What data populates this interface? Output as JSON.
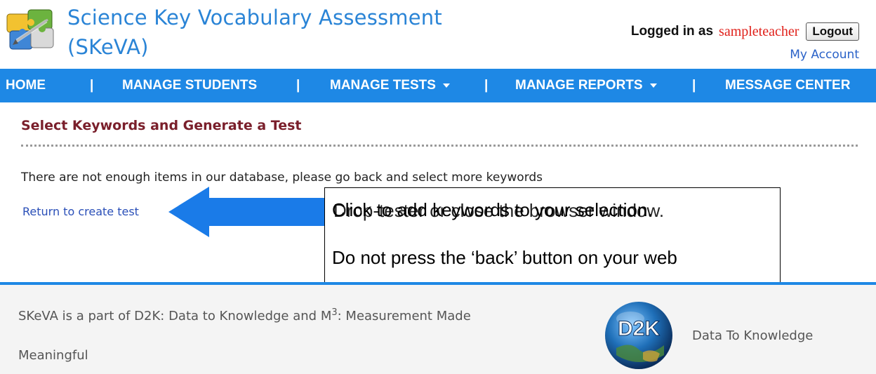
{
  "header": {
    "app_title_line1": "Science Key Vocabulary Assessment",
    "app_title_line2": "(SKeVA)",
    "logged_in_prefix": "Logged in as",
    "username": "sampleteacher",
    "logout_label": "Logout",
    "my_account_label": "My Account",
    "title_color": "#2a84d6",
    "username_color": "#e0201a"
  },
  "nav": {
    "background": "#1e88e5",
    "items": [
      {
        "label": "HOME",
        "has_dropdown": false
      },
      {
        "label": "MANAGE STUDENTS",
        "has_dropdown": false
      },
      {
        "label": "MANAGE TESTS",
        "has_dropdown": true
      },
      {
        "label": "MANAGE REPORTS",
        "has_dropdown": true
      },
      {
        "label": "MESSAGE CENTER",
        "has_dropdown": false
      }
    ],
    "separator": "|"
  },
  "main": {
    "page_title": "Select Keywords and Generate a Test",
    "message": "There are not enough items in our database, please go back and select more keywords",
    "return_link": "Return to create test"
  },
  "callout": {
    "line1_a": "Click to add keywords to your selection.",
    "line1_b": "Drop-tester or close the browser window.",
    "line2": "Do not press the ‘back’ button on your web",
    "arrow_color": "#1a7be8"
  },
  "footer": {
    "text_pre": "SKeVA is a part of D2K: Data to Knowledge and M",
    "text_sup": "3",
    "text_post": ": Measurement Made",
    "text_line2": "Meaningful",
    "logo_text": "D2K",
    "logo_label": "Data To Knowledge"
  }
}
